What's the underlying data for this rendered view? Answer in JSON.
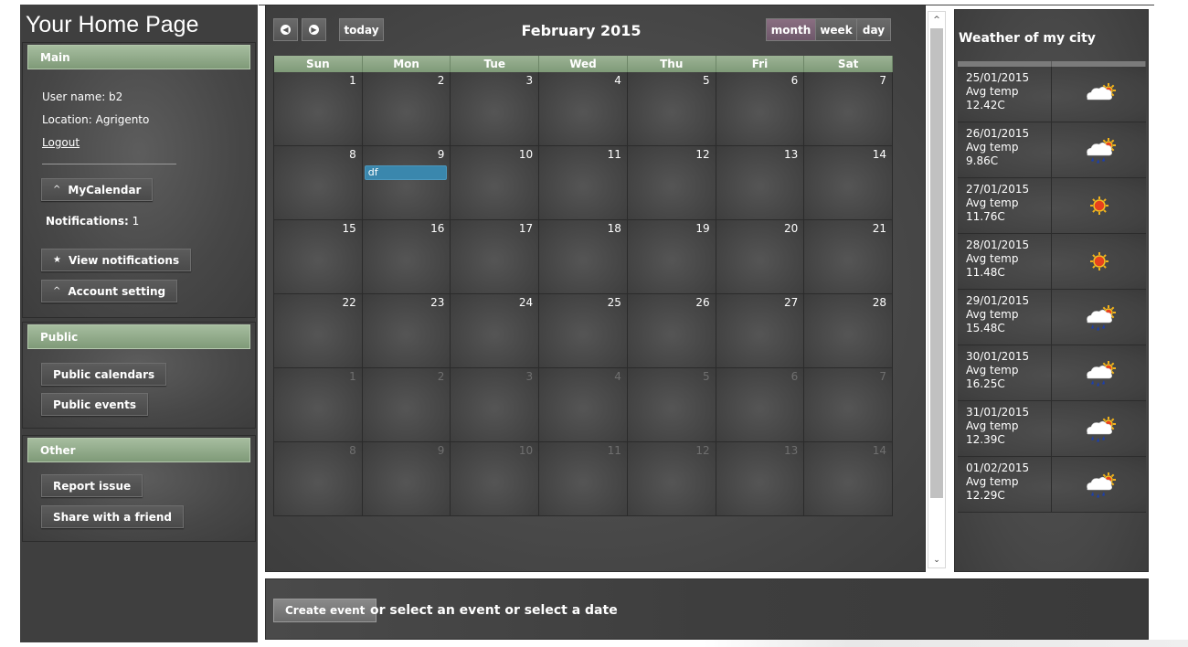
{
  "site_title": "Your Home Page",
  "sidebar": {
    "main": {
      "header": "Main",
      "user_name": "User name: b2",
      "location": "Location: Agrigento",
      "logout": "Logout",
      "my_calendar": "MyCalendar",
      "notifications_label": "Notifications:",
      "notifications_count": "1",
      "view_notifications": "View notifications",
      "account_setting": "Account setting"
    },
    "public": {
      "header": "Public",
      "public_calendars": "Public calendars",
      "public_events": "Public events"
    },
    "other": {
      "header": "Other",
      "report_issue": "Report issue",
      "share": "Share with a friend"
    }
  },
  "calendar": {
    "title": "February 2015",
    "today_label": "today",
    "views": [
      "month",
      "week",
      "day"
    ],
    "active_view": "month",
    "days_of_week": [
      "Sun",
      "Mon",
      "Tue",
      "Wed",
      "Thu",
      "Fri",
      "Sat"
    ],
    "weeks": [
      [
        "1",
        "2",
        "3",
        "4",
        "5",
        "6",
        "7"
      ],
      [
        "8",
        "9",
        "10",
        "11",
        "12",
        "13",
        "14"
      ],
      [
        "15",
        "16",
        "17",
        "18",
        "19",
        "20",
        "21"
      ],
      [
        "22",
        "23",
        "24",
        "25",
        "26",
        "27",
        "28"
      ],
      [
        "1",
        "2",
        "3",
        "4",
        "5",
        "6",
        "7"
      ],
      [
        "8",
        "9",
        "10",
        "11",
        "12",
        "13",
        "14"
      ]
    ],
    "other_month_weeks_from": 4,
    "event": {
      "title": "df",
      "day": "9"
    }
  },
  "weather": {
    "title": "Weather of my city",
    "avg_label": "Avg temp",
    "rows": [
      {
        "date": "25/01/2015",
        "temp": "12.42C",
        "icon": "cloud-sun-icon"
      },
      {
        "date": "26/01/2015",
        "temp": "9.86C",
        "icon": "rain-sun-icon"
      },
      {
        "date": "27/01/2015",
        "temp": "11.76C",
        "icon": "sun-icon"
      },
      {
        "date": "28/01/2015",
        "temp": "11.48C",
        "icon": "sun-icon"
      },
      {
        "date": "29/01/2015",
        "temp": "15.48C",
        "icon": "rain-sun-icon"
      },
      {
        "date": "30/01/2015",
        "temp": "16.25C",
        "icon": "rain-sun-icon"
      },
      {
        "date": "31/01/2015",
        "temp": "12.39C",
        "icon": "rain-sun-icon"
      },
      {
        "date": "01/02/2015",
        "temp": "12.29C",
        "icon": "rain-sun-icon"
      }
    ]
  },
  "bottom": {
    "create_event": "Create event",
    "hint": "or select an event or select a date"
  },
  "colors": {
    "accent_green": "#8fa888",
    "event_blue": "#3a87ad",
    "active_view": "#7c6476"
  }
}
